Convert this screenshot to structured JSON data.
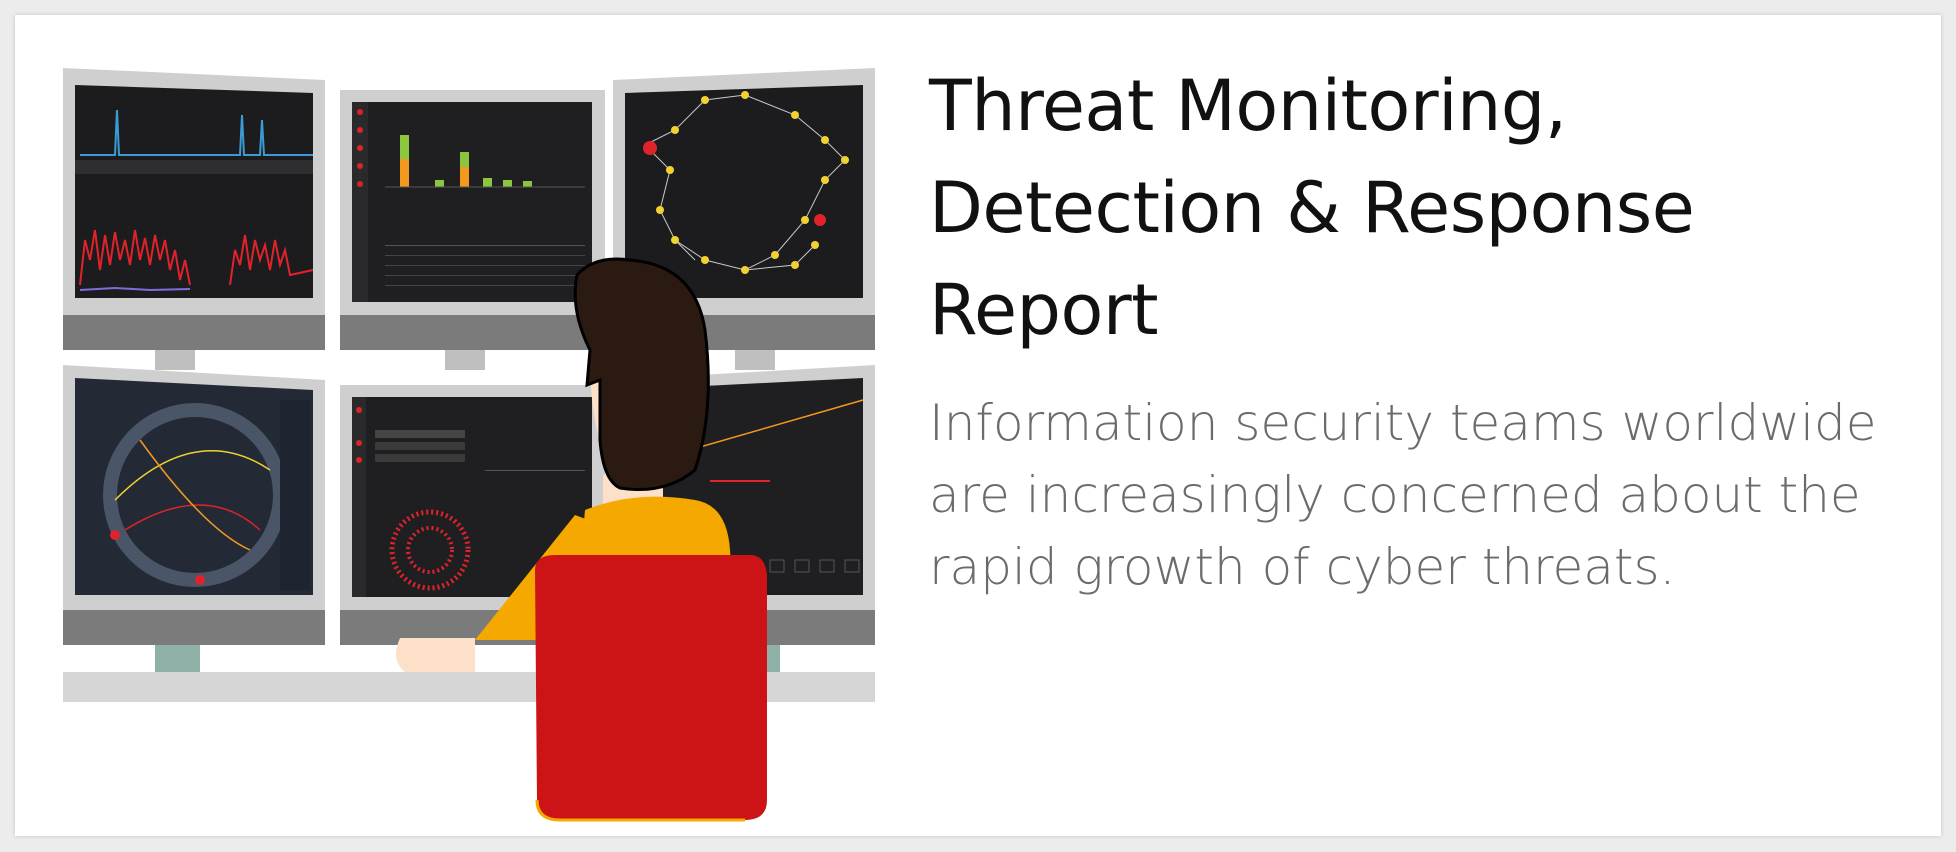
{
  "heading": {
    "lines": [
      "Threat Monitoring,",
      "Detection & Response",
      "Report"
    ]
  },
  "description": {
    "lines": [
      "Information security teams worldwide",
      "are increasingly concerned about the",
      "rapid growth of cyber threats."
    ]
  },
  "illustration": {
    "icon": "analyst-monitoring-screens-illustration",
    "colors": {
      "monitor_frame": "#c9c9c9",
      "monitor_base": "#7a7a7a",
      "screen": "#1d1d1f",
      "screen_blue": "#232a36",
      "desk": "#d2d2d2",
      "stand": "#8fb0a6",
      "hair": "#2b1a12",
      "skin": "#fde0c8",
      "shirt": "#f5a800",
      "chair": "#cc1417",
      "accent_red": "#e0232b",
      "accent_yellow": "#f2d230",
      "accent_orange": "#f39a1e",
      "accent_green": "#8cc63f"
    }
  }
}
